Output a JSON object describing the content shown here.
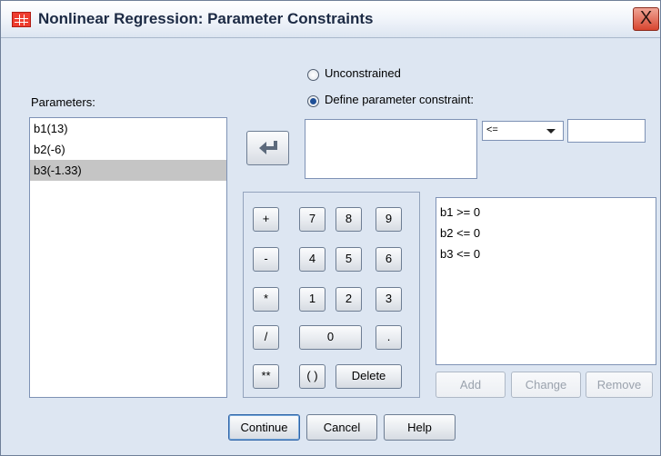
{
  "window": {
    "title": "Nonlinear Regression: Parameter Constraints",
    "close_glyph": "X"
  },
  "parameters": {
    "label": "Parameters:",
    "items": [
      "b1(13)",
      "b2(-6)",
      "b3(-1.33)"
    ],
    "selected_index": 2
  },
  "constraint_mode": {
    "unconstrained_label": "Unconstrained",
    "define_label": "Define parameter constraint:",
    "selected": "define"
  },
  "move_button": {
    "icon": "arrow-left-icon"
  },
  "expression": {
    "value": ""
  },
  "operator_select": {
    "value": "<="
  },
  "constraint_value": {
    "value": ""
  },
  "keypad": {
    "plus": "+",
    "minus": "-",
    "times": "*",
    "divide": "/",
    "power": "**",
    "seven": "7",
    "eight": "8",
    "nine": "9",
    "four": "4",
    "five": "5",
    "six": "6",
    "one": "1",
    "two": "2",
    "three": "3",
    "zero": "0",
    "dot": ".",
    "parens": "( )",
    "delete": "Delete"
  },
  "constraints": {
    "items": [
      "b1 >= 0",
      "b2 <= 0",
      "b3 <= 0"
    ]
  },
  "list_actions": {
    "add": "Add",
    "change": "Change",
    "remove": "Remove"
  },
  "footer": {
    "continue": "Continue",
    "cancel": "Cancel",
    "help": "Help"
  }
}
